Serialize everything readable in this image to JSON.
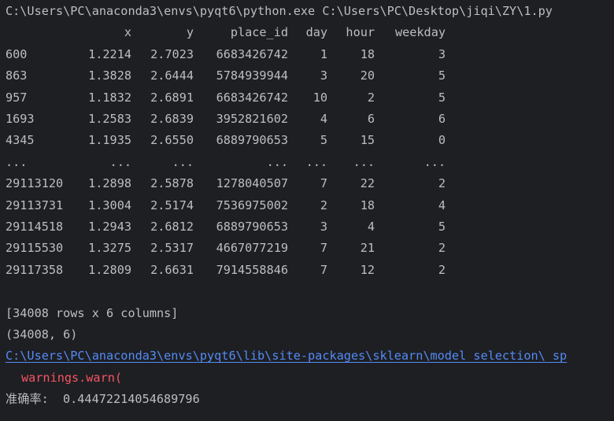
{
  "command": "C:\\Users\\PC\\anaconda3\\envs\\pyqt6\\python.exe C:\\Users\\PC\\Desktop\\jiqi\\ZY\\1.py",
  "dataframe": {
    "columns": [
      "",
      "x",
      "y",
      "place_id",
      "day",
      "hour",
      "weekday"
    ],
    "rows": [
      [
        "600",
        "1.2214",
        "2.7023",
        "6683426742",
        "1",
        "18",
        "3"
      ],
      [
        "863",
        "1.3828",
        "2.6444",
        "5784939944",
        "3",
        "20",
        "5"
      ],
      [
        "957",
        "1.1832",
        "2.6891",
        "6683426742",
        "10",
        "2",
        "5"
      ],
      [
        "1693",
        "1.2583",
        "2.6839",
        "3952821602",
        "4",
        "6",
        "6"
      ],
      [
        "4345",
        "1.1935",
        "2.6550",
        "6889790653",
        "5",
        "15",
        "0"
      ],
      [
        "...",
        "...",
        "...",
        "...",
        "...",
        "...",
        "..."
      ],
      [
        "29113120",
        "1.2898",
        "2.5878",
        "1278040507",
        "7",
        "22",
        "2"
      ],
      [
        "29113731",
        "1.3004",
        "2.5174",
        "7536975002",
        "2",
        "18",
        "4"
      ],
      [
        "29114518",
        "1.2943",
        "2.6812",
        "6889790653",
        "3",
        "4",
        "5"
      ],
      [
        "29115530",
        "1.3275",
        "2.5317",
        "4667077219",
        "7",
        "21",
        "2"
      ],
      [
        "29117358",
        "1.2809",
        "2.6631",
        "7914558846",
        "7",
        "12",
        "2"
      ]
    ],
    "summary": "[34008 rows x 6 columns]"
  },
  "shape": "(34008, 6)",
  "warning_path": "C:\\Users\\PC\\anaconda3\\envs\\pyqt6\\lib\\site-packages\\sklearn\\model_selection\\_sp",
  "warning_call": "warnings.warn(",
  "accuracy": "准确率:  0.44472214054689796",
  "colors": {
    "background": "#1e1f22",
    "text": "#bcbec4",
    "link": "#548af7",
    "warning": "#f75464"
  }
}
